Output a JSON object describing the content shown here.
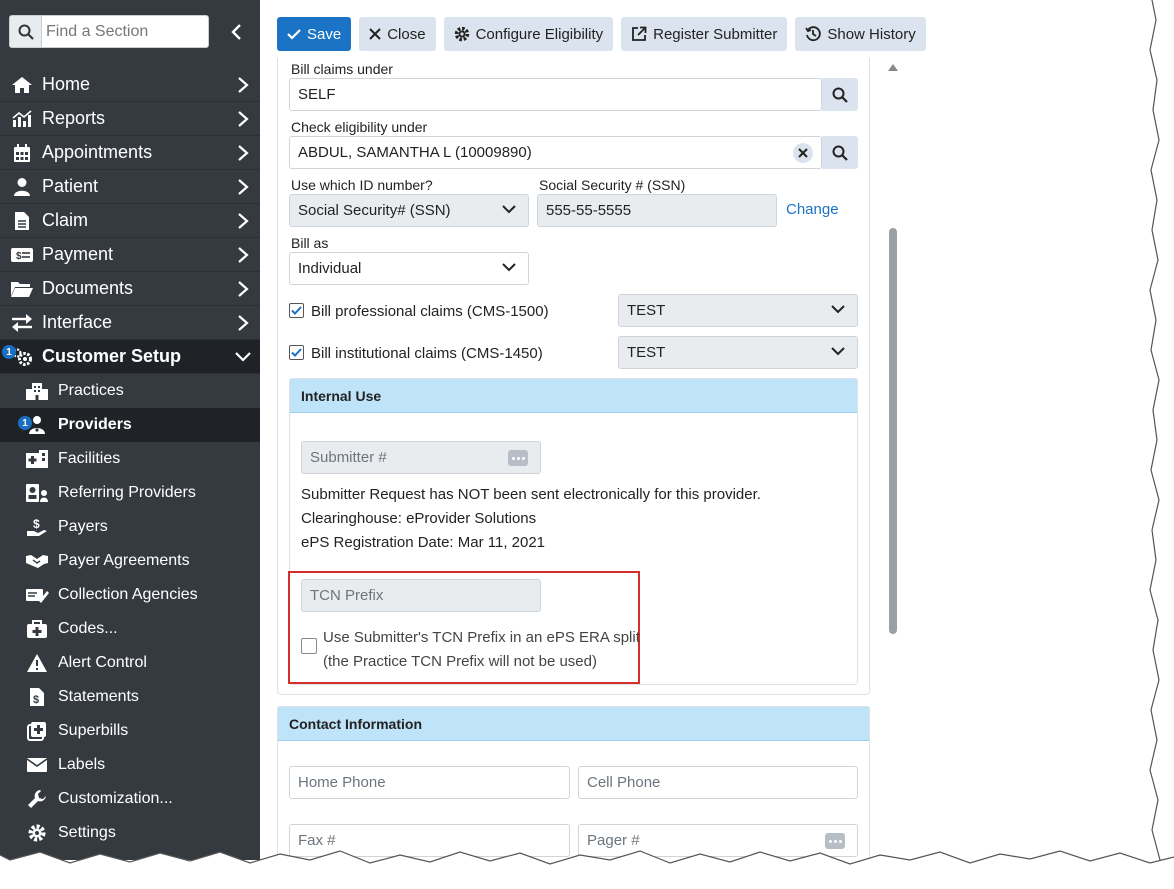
{
  "sidebar": {
    "search_placeholder": "Find a Section",
    "nav": [
      {
        "label": "Home",
        "icon": "home-icon"
      },
      {
        "label": "Reports",
        "icon": "chart-icon"
      },
      {
        "label": "Appointments",
        "icon": "calendar-icon"
      },
      {
        "label": "Patient",
        "icon": "user-icon"
      },
      {
        "label": "Claim",
        "icon": "file-icon"
      },
      {
        "label": "Payment",
        "icon": "money-icon"
      },
      {
        "label": "Documents",
        "icon": "folder-icon"
      },
      {
        "label": "Interface",
        "icon": "exchange-icon"
      },
      {
        "label": "Customer Setup",
        "icon": "gears-icon",
        "badge": "1"
      }
    ],
    "sub_items": [
      {
        "label": "Practices",
        "icon": "building-icon"
      },
      {
        "label": "Providers",
        "icon": "provider-icon",
        "badge": "1"
      },
      {
        "label": "Facilities",
        "icon": "hospital-icon"
      },
      {
        "label": "Referring Providers",
        "icon": "referring-icon"
      },
      {
        "label": "Payers",
        "icon": "payer-icon"
      },
      {
        "label": "Payer Agreements",
        "icon": "handshake-icon"
      },
      {
        "label": "Collection Agencies",
        "icon": "collection-icon"
      },
      {
        "label": "Codes...",
        "icon": "medkit-icon"
      },
      {
        "label": "Alert Control",
        "icon": "alert-icon"
      },
      {
        "label": "Statements",
        "icon": "statement-icon"
      },
      {
        "label": "Superbills",
        "icon": "superbill-icon"
      },
      {
        "label": "Labels",
        "icon": "envelope-icon"
      },
      {
        "label": "Customization...",
        "icon": "wrench-icon"
      },
      {
        "label": "Settings",
        "icon": "gear-icon"
      }
    ]
  },
  "toolbar": {
    "save": "Save",
    "close": "Close",
    "configure_eligibility": "Configure Eligibility",
    "register_submitter": "Register Submitter",
    "show_history": "Show History"
  },
  "form": {
    "bill_claims_under_label": "Bill claims under",
    "bill_claims_under_value": "SELF",
    "check_eligibility_label": "Check eligibility under",
    "check_eligibility_value": "ABDUL, SAMANTHA L (10009890)",
    "id_number_label": "Use which ID number?",
    "id_number_value": "Social Security# (SSN)",
    "ssn_label": "Social Security # (SSN)",
    "ssn_value": "555-55-5555",
    "change_link": "Change",
    "bill_as_label": "Bill as",
    "bill_as_value": "Individual",
    "professional_label": "Bill professional claims (CMS-1500)",
    "professional_value": "TEST",
    "institutional_label": "Bill institutional claims (CMS-1450)",
    "institutional_value": "TEST"
  },
  "internal_use": {
    "title": "Internal Use",
    "submitter_placeholder": "Submitter #",
    "status_text": "Submitter Request has NOT been sent electronically for this provider.",
    "clearinghouse": "Clearinghouse: eProvider Solutions",
    "registration_date": "ePS Registration Date: Mar 11, 2021",
    "tcn_placeholder": "TCN Prefix",
    "tcn_checkbox_line1": "Use Submitter's TCN Prefix in an ePS ERA split",
    "tcn_checkbox_line2": "(the Practice TCN Prefix will not be used)"
  },
  "contact": {
    "title": "Contact Information",
    "home_phone": "Home Phone",
    "cell_phone": "Cell Phone",
    "fax": "Fax #",
    "pager": "Pager #"
  },
  "colors": {
    "sidebar_bg": "#343a40",
    "primary": "#1a73c5",
    "section_header": "#bfe3f9",
    "highlight_border": "#d32f2f"
  }
}
